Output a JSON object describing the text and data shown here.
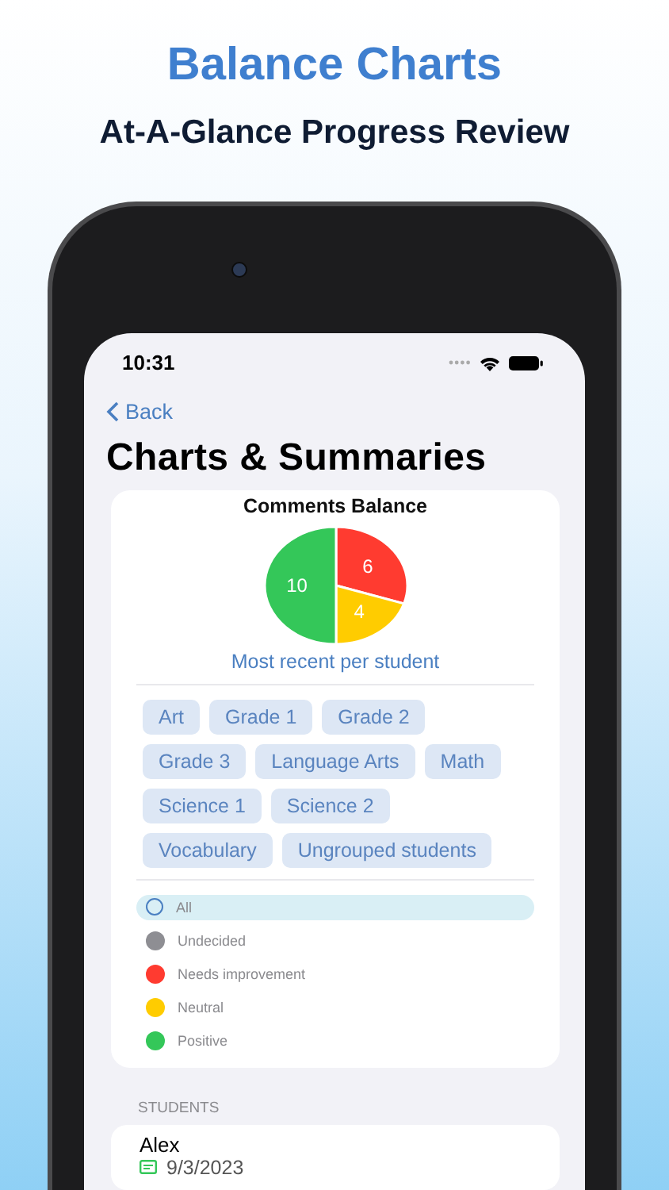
{
  "promo": {
    "title": "Balance Charts",
    "subtitle": "At-A-Glance Progress Review"
  },
  "status_bar": {
    "time": "10:31"
  },
  "nav": {
    "back": "Back",
    "title": "Charts & Summaries"
  },
  "chart": {
    "chart_data": {
      "type": "pie",
      "title": "Comments Balance",
      "series": [
        {
          "values": [
            6,
            4,
            10
          ]
        }
      ],
      "data_labels": true
    },
    "caption": "Most recent per student"
  },
  "groups": [
    "Art",
    "Grade 1",
    "Grade 2",
    "Grade 3",
    "Language Arts",
    "Math",
    "Science 1",
    "Science 2",
    "Vocabulary",
    "Ungrouped students"
  ],
  "filters": [
    {
      "kind": "all",
      "label": "All",
      "selected": true
    },
    {
      "kind": "dot",
      "label": "Undecided",
      "color": "#8e8e93",
      "selected": false
    },
    {
      "kind": "dot",
      "label": "Needs improvement",
      "color": "#ff3b30",
      "selected": false
    },
    {
      "kind": "dot",
      "label": "Neutral",
      "color": "#ffcc00",
      "selected": false
    },
    {
      "kind": "dot",
      "label": "Positive",
      "color": "#34c759",
      "selected": false
    }
  ],
  "students": {
    "header": "STUDENTS",
    "rows": [
      {
        "name": "Alex",
        "date": "9/3/2023"
      }
    ]
  }
}
